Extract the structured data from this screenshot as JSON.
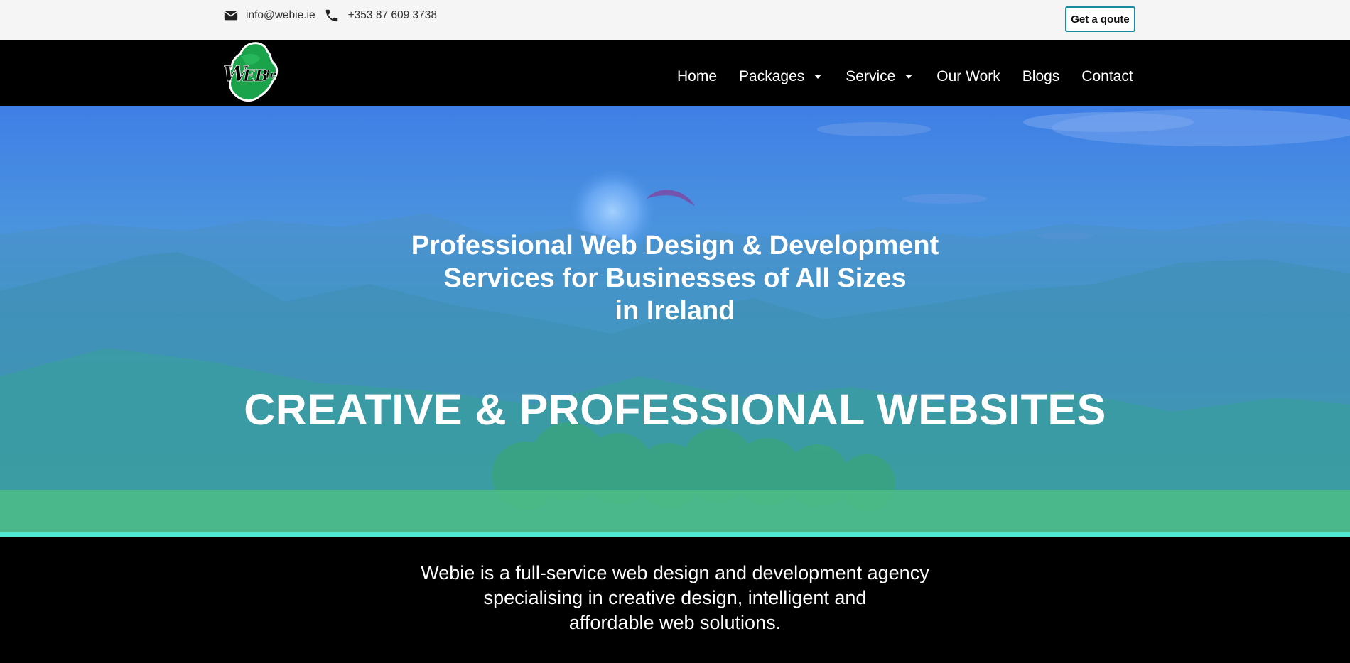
{
  "topbar": {
    "email": "info@webie.ie",
    "phone": "+353 87 609 3738",
    "quote_button": "Get a qoute",
    "icons": [
      "email-icon",
      "phone-icon"
    ]
  },
  "brand": {
    "logo_text": "WEBie",
    "logo_colors": {
      "map": "#1aa34a",
      "text": "#000000"
    }
  },
  "nav": {
    "items": [
      {
        "label": "Home",
        "dropdown": false
      },
      {
        "label": "Packages",
        "dropdown": true
      },
      {
        "label": "Service",
        "dropdown": true
      },
      {
        "label": "Our Work",
        "dropdown": false
      },
      {
        "label": "Blogs",
        "dropdown": false
      },
      {
        "label": "Contact",
        "dropdown": false
      }
    ]
  },
  "hero": {
    "title_lines": [
      "Professional Web Design & Development",
      "Services for Businesses of All Sizes",
      "in Ireland"
    ],
    "headline": "CREATIVE & PROFESSIONAL WEBSITES",
    "accent_color": "#4ee8d4"
  },
  "intro": {
    "lines": [
      "Webie is a full-service web design and development agency",
      "specialising in creative design, intelligent and",
      "affordable web solutions."
    ]
  }
}
